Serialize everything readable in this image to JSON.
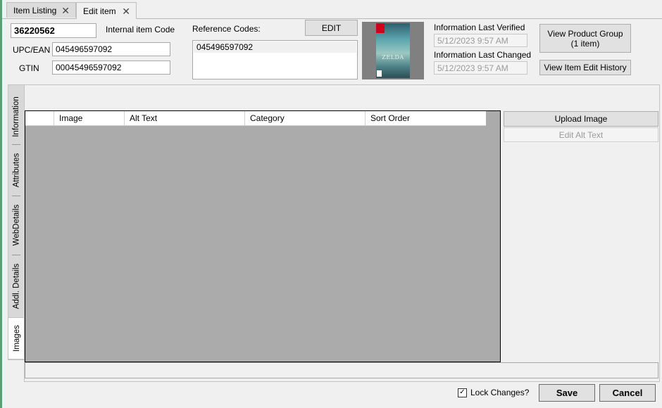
{
  "tabs": [
    {
      "label": "Item Listing"
    },
    {
      "label": "Edit item"
    }
  ],
  "icons": {
    "close": "✕",
    "check": "✓"
  },
  "header": {
    "item_number": "36220562",
    "internal_code_label": "Internal item Code",
    "upc_label": "UPC/EAN",
    "upc_value": "045496597092",
    "gtin_label": "GTIN",
    "gtin_value": "00045496597092",
    "reference_codes_label": "Reference Codes:",
    "edit_button": "EDIT",
    "reference_codes": [
      "045496597092"
    ],
    "cover_logo": "ZELDA",
    "last_verified_label": "Information Last Verified",
    "last_verified_value": "5/12/2023 9:57 AM",
    "last_changed_label": "Information Last Changed",
    "last_changed_value": "5/12/2023 9:57 AM",
    "view_product_group_line1": "View Product Group",
    "view_product_group_line2": "(1 item)",
    "view_edit_history": "View Item Edit History"
  },
  "side_tabs": [
    {
      "label": "Information"
    },
    {
      "label": "Attributes"
    },
    {
      "label": "WebDetails"
    },
    {
      "label": "Addl. Details"
    },
    {
      "label": "Images",
      "active": true
    }
  ],
  "images_grid": {
    "columns": [
      "",
      "Image",
      "Alt Text",
      "Category",
      "Sort Order"
    ],
    "rows": []
  },
  "image_actions": {
    "upload": "Upload Image",
    "edit_alt": "Edit Alt Text"
  },
  "footer": {
    "lock_label": "Lock Changes?",
    "lock_checked": true,
    "save": "Save",
    "cancel": "Cancel"
  },
  "colors": {
    "grid_background": "#ababab",
    "window_background": "#f0f0f0",
    "left_edge": "#5a9e73"
  }
}
